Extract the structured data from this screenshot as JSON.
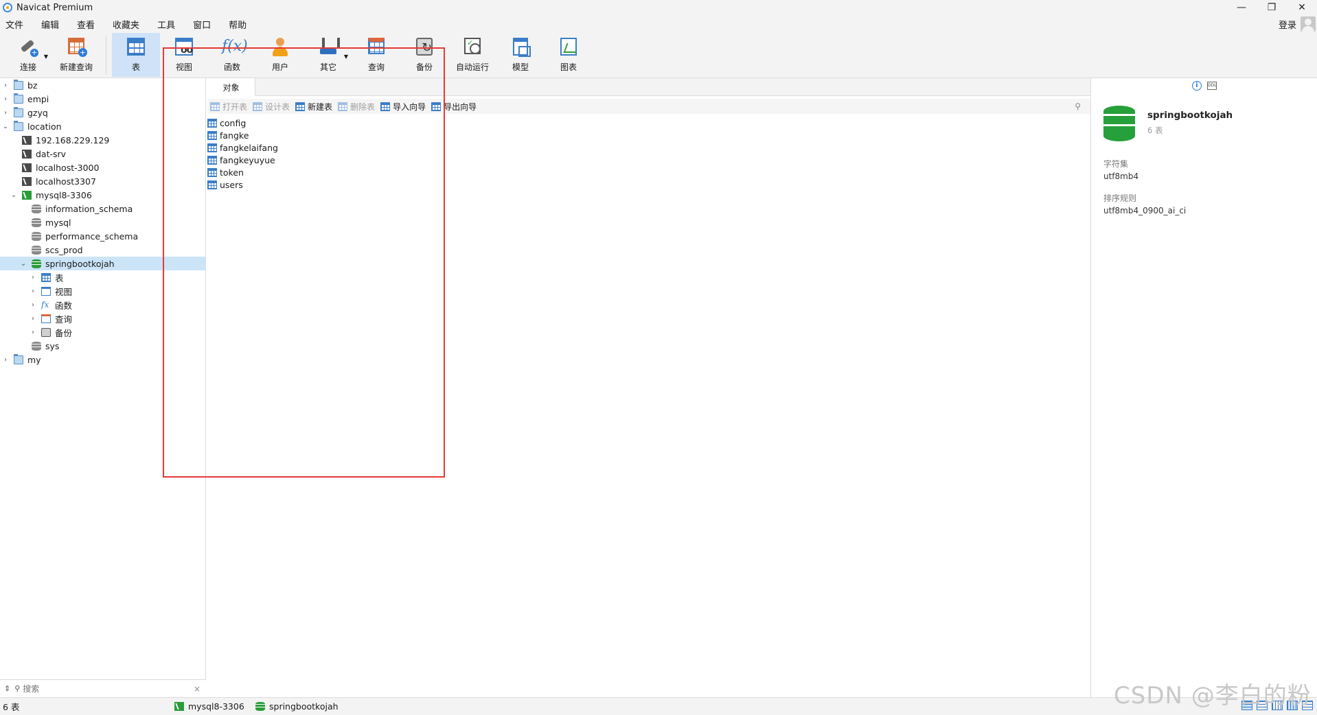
{
  "window": {
    "title": "Navicat Premium"
  },
  "menu": [
    "文件",
    "编辑",
    "查看",
    "收藏夹",
    "工具",
    "窗口",
    "帮助"
  ],
  "login_label": "登录",
  "toolbar": {
    "connect": "连接",
    "new_query": "新建查询",
    "table": "表",
    "view": "视图",
    "function": "函数",
    "user": "用户",
    "other": "其它",
    "query": "查询",
    "backup": "备份",
    "auto_run": "自动运行",
    "model": "模型",
    "chart": "图表"
  },
  "tree": {
    "items": [
      {
        "label": "bz"
      },
      {
        "label": "empi"
      },
      {
        "label": "gzyq"
      },
      {
        "label": "location"
      },
      {
        "label": "192.168.229.129"
      },
      {
        "label": "dat-srv"
      },
      {
        "label": "localhost-3000"
      },
      {
        "label": "localhost3307"
      },
      {
        "label": "mysql8-3306"
      },
      {
        "label": "information_schema"
      },
      {
        "label": "mysql"
      },
      {
        "label": "performance_schema"
      },
      {
        "label": "scs_prod"
      },
      {
        "label": "springbootkojah"
      },
      {
        "label": "表"
      },
      {
        "label": "视图"
      },
      {
        "label": "函数"
      },
      {
        "label": "查询"
      },
      {
        "label": "备份"
      },
      {
        "label": "sys"
      },
      {
        "label": "my"
      }
    ],
    "search_placeholder": "搜索"
  },
  "center": {
    "tab": "对象",
    "actions": {
      "open_table": "打开表",
      "design_table": "设计表",
      "new_table": "新建表",
      "delete_table": "删除表",
      "import_wizard": "导入向导",
      "export_wizard": "导出向导"
    },
    "tables": [
      "config",
      "fangke",
      "fangkelaifang",
      "fangkeyuyue",
      "token",
      "users"
    ]
  },
  "info": {
    "db_name": "springbootkojah",
    "table_count": "6 表",
    "charset_label": "字符集",
    "charset_value": "utf8mb4",
    "collation_label": "排序规则",
    "collation_value": "utf8mb4_0900_ai_ci"
  },
  "status": {
    "count": "6 表",
    "connection": "mysql8-3306",
    "database": "springbootkojah"
  },
  "watermark": "CSDN @李白的粉",
  "colors": {
    "accent": "#2d7ad6",
    "selection": "#cce4f7",
    "highlight_box": "#e53935",
    "db_green": "#26a03a"
  }
}
